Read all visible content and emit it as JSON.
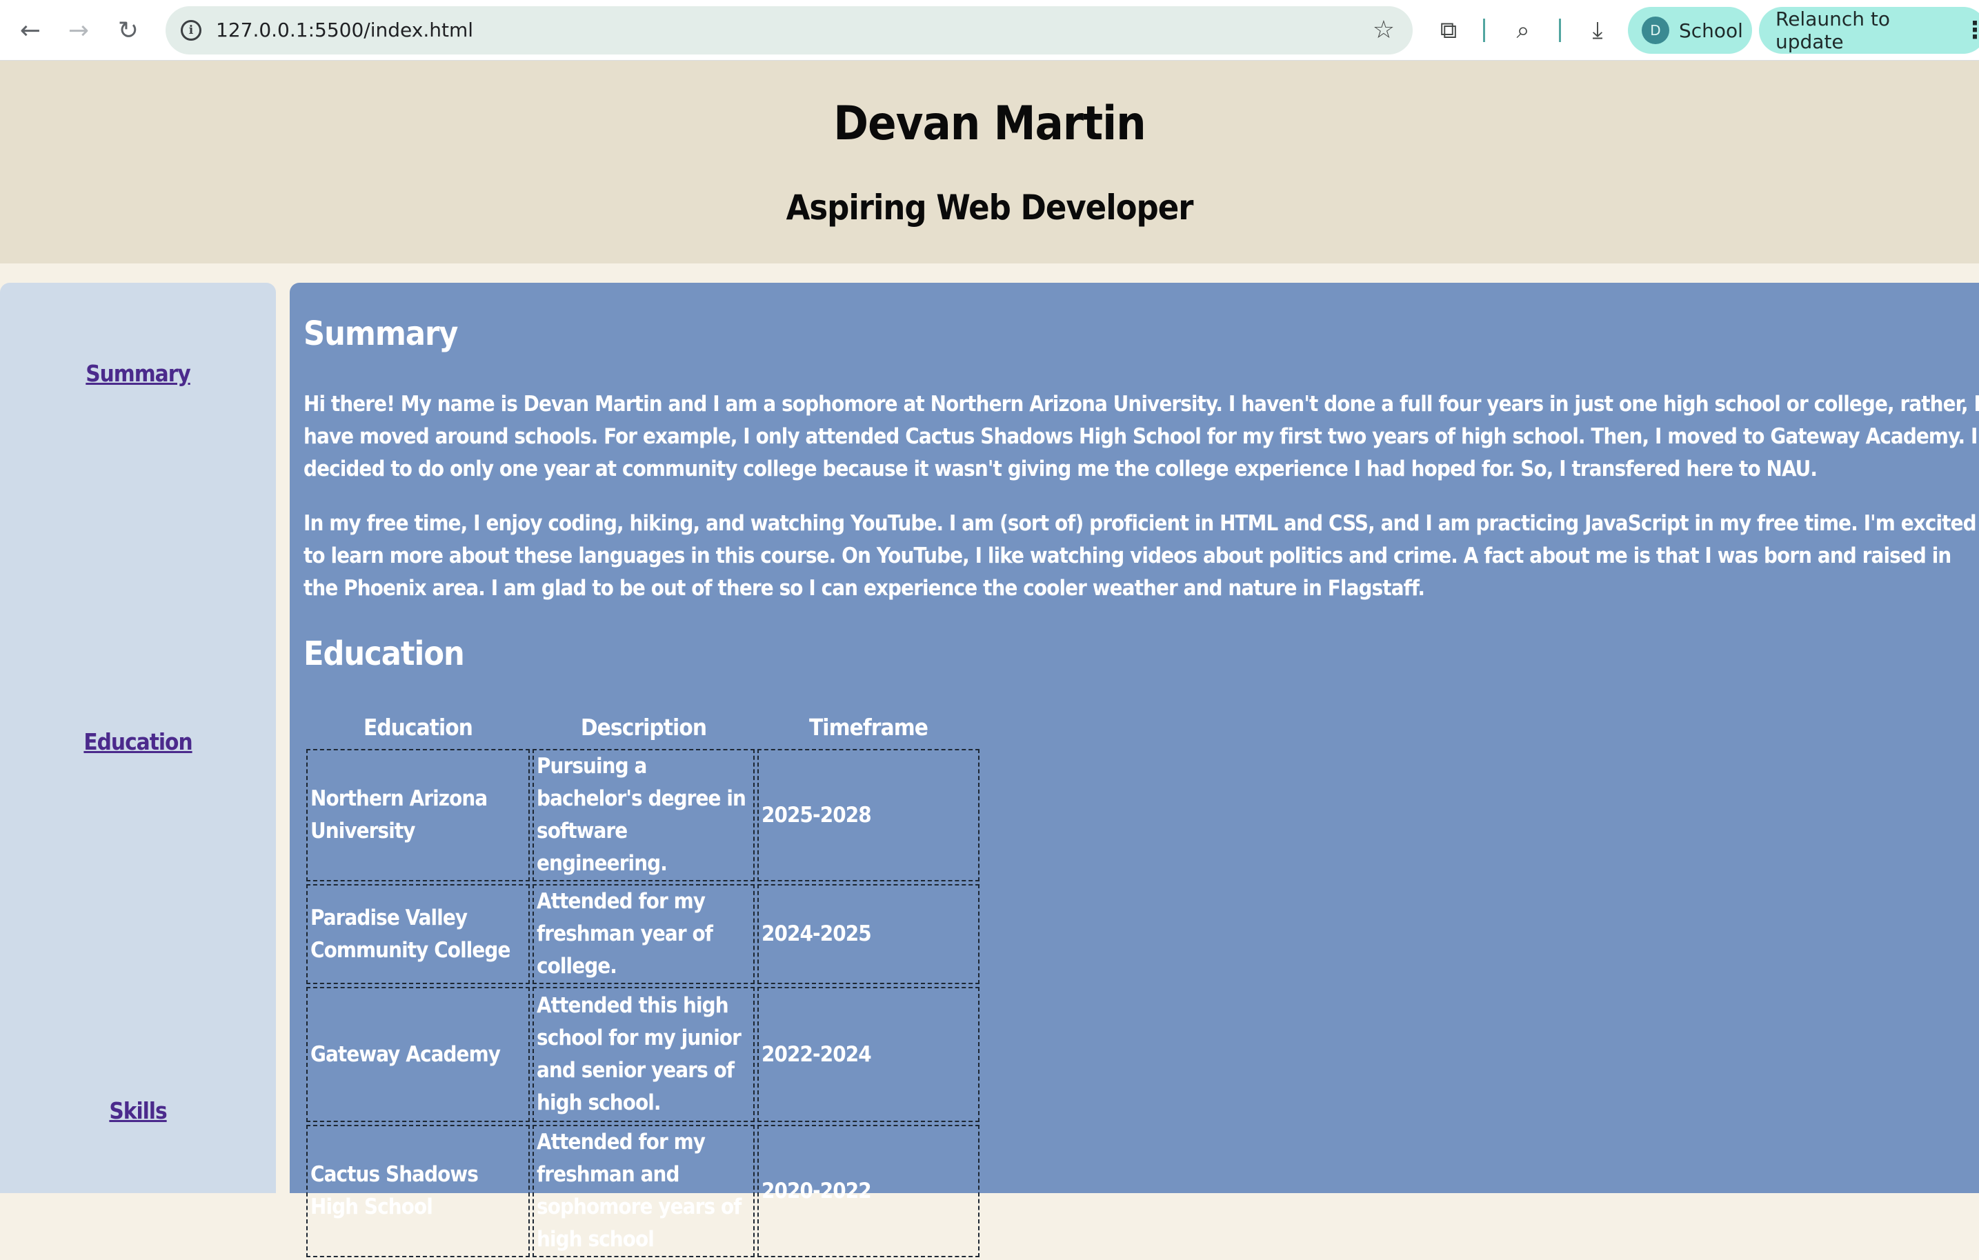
{
  "browser": {
    "url": "127.0.0.1:5500/index.html",
    "profile_initial": "D",
    "profile_name": "School",
    "relaunch_label": "Relaunch to update",
    "icons": {
      "back": "←",
      "forward": "→",
      "reload": "↻",
      "info": "i",
      "star": "☆",
      "extensions": "⧉",
      "search_tabs": "⌕",
      "download": "⤓",
      "menu": "⋮"
    }
  },
  "header": {
    "name": "Devan Martin",
    "tagline": "Aspiring Web Developer"
  },
  "sidebar": {
    "links": [
      {
        "label": "Summary"
      },
      {
        "label": "Education"
      },
      {
        "label": "Skills"
      }
    ]
  },
  "summary": {
    "title": "Summary",
    "paragraphs": [
      "Hi there! My name is Devan Martin and I am a sophomore at Northern Arizona University. I haven't done a full four years in just one high school or college, rather, I have moved around schools. For example, I only attended Cactus Shadows High School for my first two years of high school. Then, I moved to Gateway Academy. I decided to do only one year at community college because it wasn't giving me the college experience I had hoped for. So, I transfered here to NAU.",
      "In my free time, I enjoy coding, hiking, and watching YouTube. I am (sort of) proficient in HTML and CSS, and I am practicing JavaScript in my free time. I'm excited to learn more about these languages in this course. On YouTube, I like watching videos about politics and crime. A fact about me is that I was born and raised in the Phoenix area. I am glad to be out of there so I can experience the cooler weather and nature in Flagstaff."
    ]
  },
  "education": {
    "title": "Education",
    "headers": [
      "Education",
      "Description",
      "Timeframe"
    ],
    "rows": [
      [
        "Northern Arizona University",
        "Pursuing a bachelor's degree in software engineering.",
        "2025-2028"
      ],
      [
        "Paradise Valley Community College",
        "Attended for my freshman year of college.",
        "2024-2025"
      ],
      [
        "Gateway Academy",
        "Attended this high school for my junior and senior years of high school.",
        "2022-2024"
      ],
      [
        "Cactus Shadows High School",
        "Attended for my freshman and sophomore years of high school",
        "2020-2022"
      ]
    ]
  }
}
